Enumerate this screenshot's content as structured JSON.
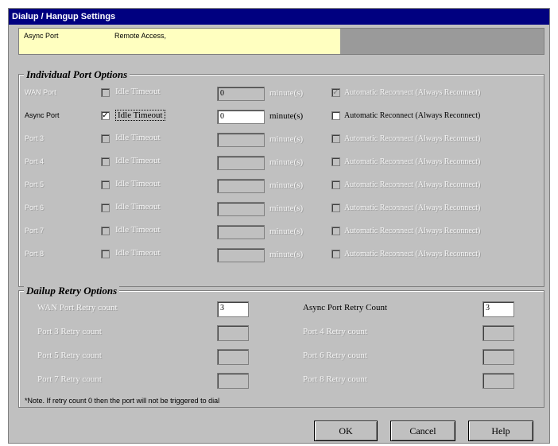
{
  "window": {
    "title": "Dialup / Hangup Settings"
  },
  "info": {
    "port": "Async Port",
    "service": "Remote Access,"
  },
  "individual": {
    "legend": "Individual Port Options",
    "unit": "minute(s)",
    "rows": [
      {
        "port": "WAN Port",
        "idle_label": "Idle Timeout",
        "value": "0",
        "reconnect": "Automatic Reconnect (Always Reconnect)"
      },
      {
        "port": "Async Port",
        "idle_label": "Idle Timeout",
        "value": "0",
        "reconnect": "Automatic Reconnect (Always Reconnect)"
      },
      {
        "port": "Port 3",
        "idle_label": "Idle Timeout",
        "value": "",
        "reconnect": "Automatic Reconnect (Always Reconnect)"
      },
      {
        "port": "Port 4",
        "idle_label": "Idle Timeout",
        "value": "",
        "reconnect": "Automatic Reconnect (Always Reconnect)"
      },
      {
        "port": "Port 5",
        "idle_label": "Idle Timeout",
        "value": "",
        "reconnect": "Automatic Reconnect (Always Reconnect)"
      },
      {
        "port": "Port 6",
        "idle_label": "Idle Timeout",
        "value": "",
        "reconnect": "Automatic Reconnect (Always Reconnect)"
      },
      {
        "port": "Port 7",
        "idle_label": "Idle Timeout",
        "value": "",
        "reconnect": "Automatic Reconnect (Always Reconnect)"
      },
      {
        "port": "Port 8",
        "idle_label": "Idle Timeout",
        "value": "",
        "reconnect": "Automatic Reconnect (Always Reconnect)"
      }
    ]
  },
  "retry": {
    "legend": "Dailup Retry Options",
    "left": [
      {
        "label": "WAN Port Retry count",
        "value": "3"
      },
      {
        "label": "Port 3 Retry count",
        "value": ""
      },
      {
        "label": "Port 5 Retry count",
        "value": ""
      },
      {
        "label": "Port 7 Retry count",
        "value": ""
      }
    ],
    "right": [
      {
        "label": "Async Port Retry Count",
        "value": "3"
      },
      {
        "label": "Port 4 Retry count",
        "value": ""
      },
      {
        "label": "Port 6 Retry count",
        "value": ""
      },
      {
        "label": "Port 8 Retry count",
        "value": ""
      }
    ],
    "note": "*Note. If retry count 0 then the port will not be triggered to dial"
  },
  "buttons": {
    "ok": "OK",
    "cancel": "Cancel",
    "help": "Help"
  },
  "colors": {
    "titlebar": "#000080",
    "info_bg": "#ffffc0",
    "face": "#c0c0c0"
  }
}
